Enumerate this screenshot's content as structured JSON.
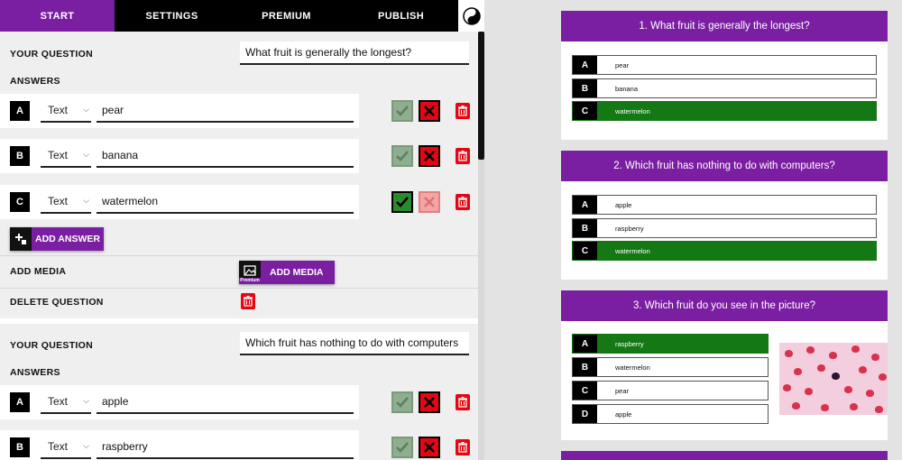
{
  "nav": {
    "tabs": [
      "START",
      "SETTINGS",
      "PREMIUM",
      "PUBLISH"
    ],
    "active_tab": "START",
    "mode_icon": "yin-yang-icon"
  },
  "editor": {
    "question_label": "YOUR QUESTION",
    "answers_label": "ANSWERS",
    "add_answer_label": "ADD ANSWER",
    "add_media_label": "ADD MEDIA",
    "add_media_button_label": "ADD MEDIA",
    "premium_tag": "Premium",
    "delete_question_label": "DELETE QUESTION",
    "type_default": "Text",
    "questions": [
      {
        "text": "What fruit is generally the longest?",
        "answers": [
          {
            "letter": "A",
            "type": "Text",
            "value": "pear",
            "correct": false
          },
          {
            "letter": "B",
            "type": "Text",
            "value": "banana",
            "correct": false
          },
          {
            "letter": "C",
            "type": "Text",
            "value": "watermelon",
            "correct": true
          }
        ]
      },
      {
        "text": "Which fruit has nothing to do with computers",
        "answers": [
          {
            "letter": "A",
            "type": "Text",
            "value": "apple",
            "correct": false
          },
          {
            "letter": "B",
            "type": "Text",
            "value": "raspberry",
            "correct": false
          }
        ]
      }
    ]
  },
  "preview": {
    "cards": [
      {
        "title": "1. What fruit is generally the longest?",
        "options": [
          {
            "letter": "A",
            "text": "pear",
            "correct": false
          },
          {
            "letter": "B",
            "text": "banana",
            "correct": false
          },
          {
            "letter": "C",
            "text": "watermelon",
            "correct": true
          }
        ]
      },
      {
        "title": "2. Which fruit has nothing to do with computers?",
        "options": [
          {
            "letter": "A",
            "text": "apple",
            "correct": false
          },
          {
            "letter": "B",
            "text": "raspberry",
            "correct": false
          },
          {
            "letter": "C",
            "text": "watermelon",
            "correct": true
          }
        ]
      },
      {
        "title": "3. Which fruit do you see in the picture?",
        "options": [
          {
            "letter": "A",
            "text": "raspberry",
            "correct": true
          },
          {
            "letter": "B",
            "text": "watermelon",
            "correct": false
          },
          {
            "letter": "C",
            "text": "pear",
            "correct": false
          },
          {
            "letter": "D",
            "text": "apple",
            "correct": false
          }
        ],
        "image": "raspberries-photo"
      }
    ]
  },
  "colors": {
    "accent": "#7b1fa2",
    "correct": "#147814",
    "danger": "#e30613"
  }
}
